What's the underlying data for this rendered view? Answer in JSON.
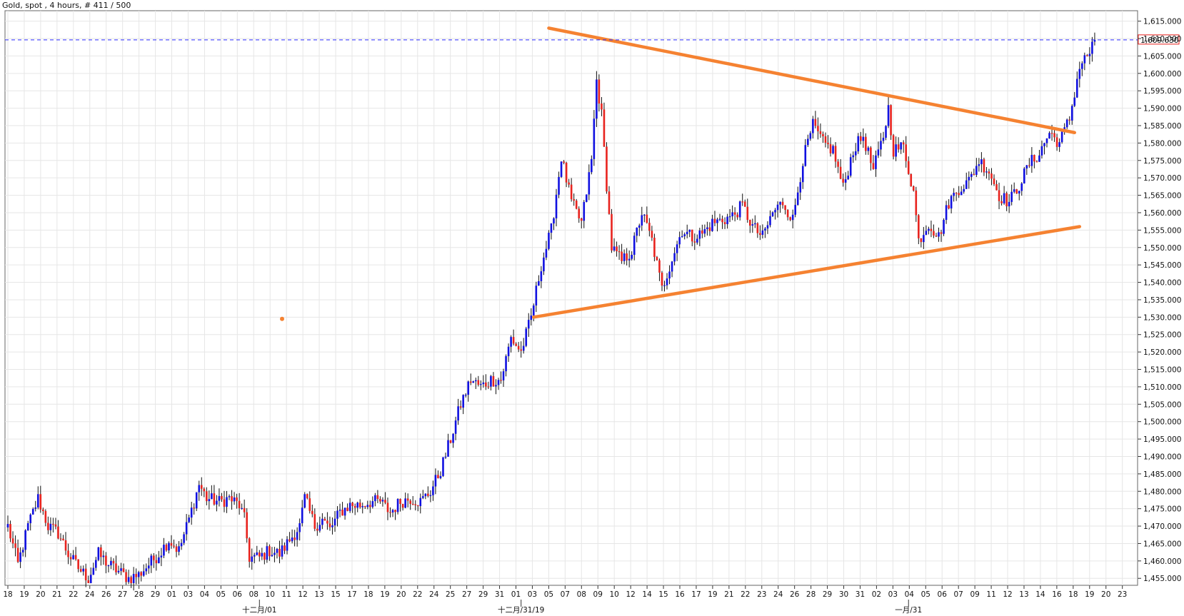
{
  "header": {
    "title": "Gold, spot , 4 hours, # 411 / 500"
  },
  "colors": {
    "up": "#1010e0",
    "down": "#e8231e",
    "wick": "#111111",
    "trendline": "#f58231",
    "price_line": "#2a2aff",
    "price_box_border": "#e8231e",
    "price_text": "#2a2aff"
  },
  "chart_data": {
    "type": "candlestick",
    "title": "Gold, spot , 4 hours, # 411 / 500",
    "ylim": [
      1453,
      1618
    ],
    "y_ticks": [
      "1,455.000",
      "1,460.000",
      "1,465.000",
      "1,470.000",
      "1,475.000",
      "1,480.000",
      "1,485.000",
      "1,490.000",
      "1,495.000",
      "1,500.000",
      "1,505.000",
      "1,510.000",
      "1,515.000",
      "1,520.000",
      "1,525.000",
      "1,530.000",
      "1,535.000",
      "1,540.000",
      "1,545.000",
      "1,550.000",
      "1,555.000",
      "1,560.000",
      "1,565.000",
      "1,570.000",
      "1,575.000",
      "1,580.000",
      "1,585.000",
      "1,590.000",
      "1,595.000",
      "1,600.000",
      "1,605.000",
      "1,610.000",
      "1,615.000"
    ],
    "x_ticks": [
      "18",
      "19",
      "20",
      "21",
      "22",
      "24",
      "26",
      "27",
      "28",
      "29",
      "01",
      "03",
      "04",
      "05",
      "06",
      "08",
      "10",
      "11",
      "12",
      "13",
      "15",
      "17",
      "18",
      "19",
      "20",
      "22",
      "24",
      "25",
      "27",
      "29",
      "31",
      "01",
      "03",
      "05",
      "07",
      "08",
      "09",
      "10",
      "12",
      "14",
      "15",
      "16",
      "17",
      "19",
      "21",
      "22",
      "23",
      "24",
      "26",
      "28",
      "29",
      "30",
      "31",
      "02",
      "03",
      "04",
      "05",
      "06",
      "07",
      "09",
      "11",
      "12",
      "13",
      "14",
      "16",
      "18",
      "19",
      "20",
      "23"
    ],
    "period_labels": [
      {
        "text": "十二月/01",
        "bar": 100
      },
      {
        "text": "十二月/31/19",
        "bar": 204
      },
      {
        "text": "一月/31",
        "bar": 358
      }
    ],
    "current_price": 1609.63,
    "current_price_label": "1,609.630",
    "anchors": [
      [
        0,
        1470
      ],
      [
        4,
        1459
      ],
      [
        8,
        1470
      ],
      [
        12,
        1478
      ],
      [
        16,
        1470
      ],
      [
        20,
        1468
      ],
      [
        24,
        1462
      ],
      [
        28,
        1458
      ],
      [
        32,
        1455
      ],
      [
        36,
        1462
      ],
      [
        40,
        1459
      ],
      [
        44,
        1457
      ],
      [
        48,
        1455
      ],
      [
        52,
        1456
      ],
      [
        56,
        1459
      ],
      [
        60,
        1462
      ],
      [
        64,
        1466
      ],
      [
        68,
        1463
      ],
      [
        72,
        1472
      ],
      [
        76,
        1482
      ],
      [
        79,
        1478
      ],
      [
        84,
        1477
      ],
      [
        88,
        1478
      ],
      [
        92,
        1476
      ],
      [
        94,
        1472
      ],
      [
        96,
        1461
      ],
      [
        100,
        1461
      ],
      [
        104,
        1463
      ],
      [
        108,
        1462
      ],
      [
        112,
        1466
      ],
      [
        116,
        1470
      ],
      [
        118,
        1478
      ],
      [
        122,
        1470
      ],
      [
        125,
        1472
      ],
      [
        128,
        1469
      ],
      [
        132,
        1474
      ],
      [
        136,
        1476
      ],
      [
        140,
        1476
      ],
      [
        144,
        1477
      ],
      [
        148,
        1477
      ],
      [
        152,
        1474
      ],
      [
        156,
        1477
      ],
      [
        160,
        1478
      ],
      [
        164,
        1477
      ],
      [
        168,
        1480
      ],
      [
        172,
        1486
      ],
      [
        176,
        1495
      ],
      [
        180,
        1505
      ],
      [
        184,
        1512
      ],
      [
        188,
        1510
      ],
      [
        192,
        1512
      ],
      [
        196,
        1512
      ],
      [
        200,
        1524
      ],
      [
        204,
        1520
      ],
      [
        208,
        1530
      ],
      [
        212,
        1545
      ],
      [
        216,
        1555
      ],
      [
        220,
        1576
      ],
      [
        224,
        1563
      ],
      [
        228,
        1557
      ],
      [
        232,
        1575
      ],
      [
        234,
        1598
      ],
      [
        236,
        1588
      ],
      [
        238,
        1568
      ],
      [
        240,
        1550
      ],
      [
        244,
        1546
      ],
      [
        248,
        1549
      ],
      [
        252,
        1560
      ],
      [
        256,
        1552
      ],
      [
        260,
        1538
      ],
      [
        264,
        1547
      ],
      [
        268,
        1555
      ],
      [
        272,
        1553
      ],
      [
        276,
        1554
      ],
      [
        280,
        1557
      ],
      [
        284,
        1558
      ],
      [
        288,
        1559
      ],
      [
        292,
        1562
      ],
      [
        296,
        1556
      ],
      [
        300,
        1553
      ],
      [
        304,
        1560
      ],
      [
        308,
        1563
      ],
      [
        312,
        1558
      ],
      [
        316,
        1575
      ],
      [
        320,
        1585
      ],
      [
        324,
        1580
      ],
      [
        328,
        1578
      ],
      [
        332,
        1567
      ],
      [
        336,
        1578
      ],
      [
        340,
        1582
      ],
      [
        344,
        1572
      ],
      [
        348,
        1582
      ],
      [
        350,
        1590
      ],
      [
        352,
        1578
      ],
      [
        356,
        1579
      ],
      [
        360,
        1566
      ],
      [
        362,
        1552
      ],
      [
        366,
        1557
      ],
      [
        370,
        1553
      ],
      [
        374,
        1563
      ],
      [
        378,
        1567
      ],
      [
        382,
        1569
      ],
      [
        386,
        1575
      ],
      [
        390,
        1572
      ],
      [
        394,
        1565
      ],
      [
        398,
        1563
      ],
      [
        402,
        1568
      ],
      [
        406,
        1574
      ],
      [
        410,
        1577
      ],
      [
        414,
        1583
      ],
      [
        418,
        1580
      ],
      [
        422,
        1587
      ],
      [
        426,
        1602
      ],
      [
        430,
        1606
      ],
      [
        432,
        1609.63
      ]
    ],
    "trendlines": [
      {
        "from": [
          215,
          1613
        ],
        "to": [
          424,
          1583
        ]
      },
      {
        "from": [
          209,
          1530
        ],
        "to": [
          426,
          1556
        ]
      }
    ],
    "marker": {
      "bar": 109,
      "y": 1529.5
    }
  }
}
